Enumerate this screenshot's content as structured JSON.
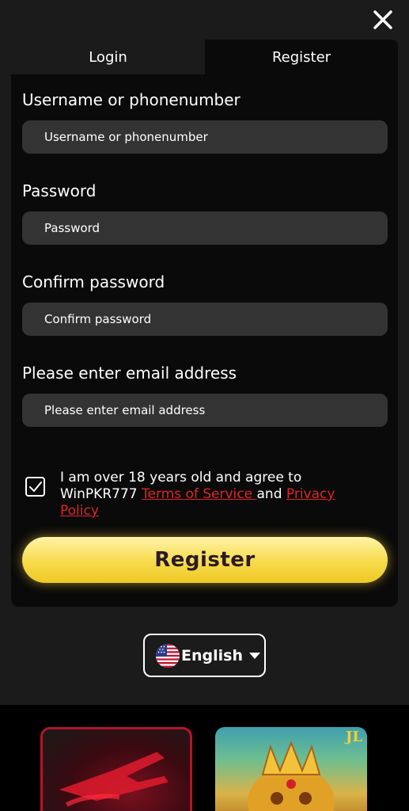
{
  "close": {
    "icon": "close-icon"
  },
  "tabs": [
    {
      "label": "Login",
      "active": false
    },
    {
      "label": "Register",
      "active": true
    }
  ],
  "form": {
    "fields": [
      {
        "label": "Username or phonenumber",
        "placeholder": "Username or phonenumber",
        "value": ""
      },
      {
        "label": "Password",
        "placeholder": "Password",
        "value": ""
      },
      {
        "label": "Confirm password",
        "placeholder": "Confirm password",
        "value": ""
      },
      {
        "label": "Please enter email address",
        "placeholder": "Please enter email address",
        "value": ""
      }
    ],
    "agreement": {
      "checked": true,
      "text_prefix": "I am over 18 years old and agree to WinPKR777 ",
      "terms_link": "Terms of Service ",
      "conjunction": "and ",
      "privacy_link": "Privacy Policy"
    },
    "submit_label": "Register"
  },
  "language": {
    "selected": "English",
    "flag": "us-flag-icon"
  },
  "games": [
    {
      "name": "aviator-game-tile"
    },
    {
      "name": "temple-game-tile",
      "badge": "JL"
    }
  ],
  "colors": {
    "accent_yellow": "#f7db4a",
    "link_red": "#e02424",
    "panel_bg": "#0a0a0a",
    "input_bg": "#333333"
  }
}
